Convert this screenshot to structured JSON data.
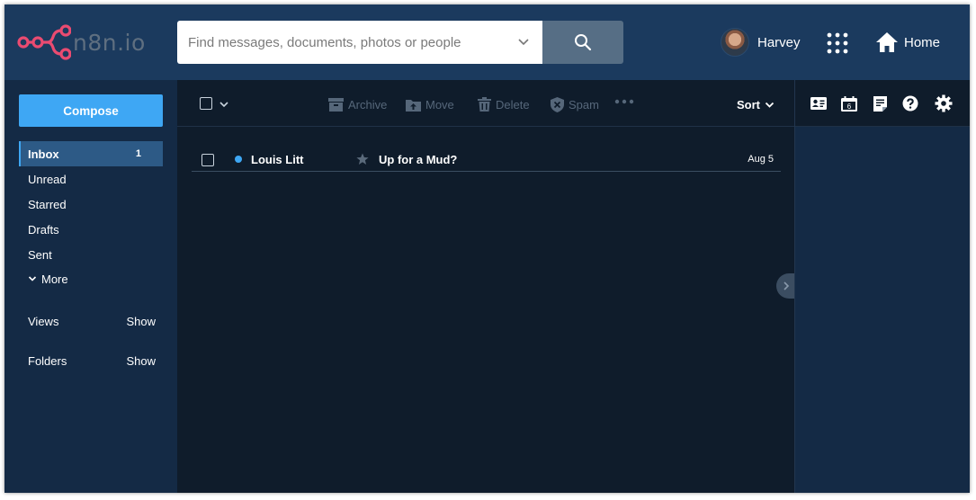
{
  "app": {
    "logo_text": "n8n.io",
    "brand_color": "#ea4b71"
  },
  "header": {
    "search_placeholder": "Find messages, documents, photos or people",
    "user_name": "Harvey",
    "home_label": "Home"
  },
  "sidebar": {
    "compose_label": "Compose",
    "items": [
      {
        "label": "Inbox",
        "count": "1",
        "active": true
      },
      {
        "label": "Unread"
      },
      {
        "label": "Starred"
      },
      {
        "label": "Drafts"
      },
      {
        "label": "Sent"
      }
    ],
    "more_label": "More",
    "views": {
      "label": "Views",
      "action": "Show"
    },
    "folders": {
      "label": "Folders",
      "action": "Show"
    }
  },
  "toolbar": {
    "archive_label": "Archive",
    "move_label": "Move",
    "delete_label": "Delete",
    "spam_label": "Spam",
    "sort_label": "Sort"
  },
  "messages": [
    {
      "sender": "Louis Litt",
      "subject": "Up for a Mud?",
      "date": "Aug 5",
      "unread": true,
      "starred": false
    }
  ],
  "right_panel": {
    "calendar_day": "6",
    "icons": [
      "contacts-icon",
      "calendar-icon",
      "notepad-icon",
      "help-icon",
      "settings-icon"
    ]
  },
  "colors": {
    "accent": "#3ea7f4",
    "header_bg": "#1b3a5e",
    "nav_bg": "#142a45",
    "list_bg": "#0f1c2b"
  }
}
